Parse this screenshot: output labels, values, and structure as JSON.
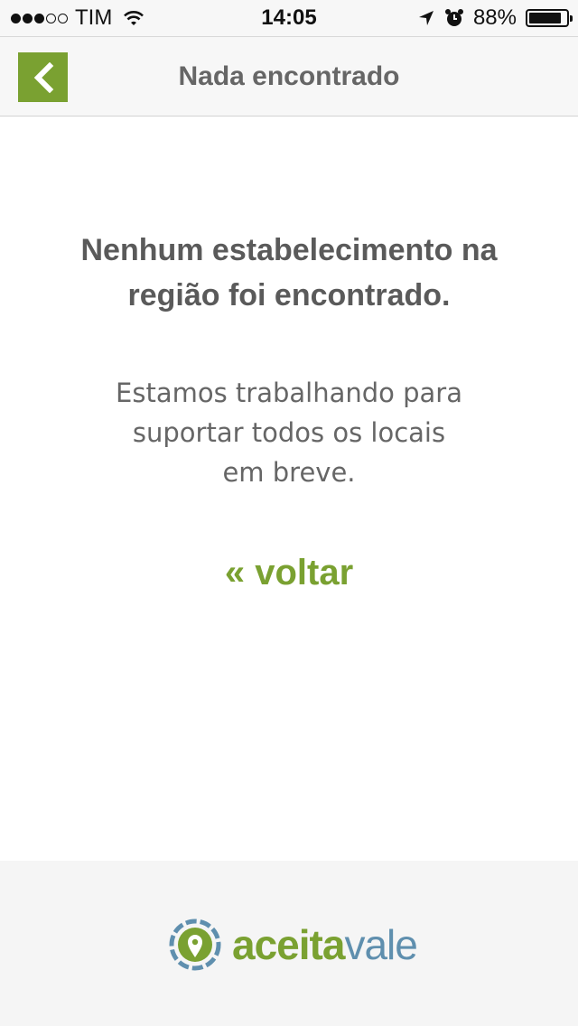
{
  "status_bar": {
    "carrier": "TIM",
    "time": "14:05",
    "battery_percent": "88%",
    "battery_level": 0.88,
    "signal_bars_filled": 3,
    "signal_bars_total": 5
  },
  "nav": {
    "title": "Nada encontrado",
    "back_icon": "chevron-left-icon"
  },
  "content": {
    "heading_line1": "Nenhum estabelecimento na",
    "heading_line2": "região foi encontrado.",
    "message_line1": "Estamos trabalhando para",
    "message_line2": "suportar todos os locais",
    "message_line3": "em breve.",
    "back_link": "« voltar"
  },
  "footer": {
    "logo_part1": "aceita",
    "logo_part2": "vale"
  },
  "colors": {
    "accent_green": "#7aa131",
    "logo_blue": "#5f8fae",
    "text_gray": "#5a5a5a",
    "bar_background": "#f7f7f7"
  }
}
